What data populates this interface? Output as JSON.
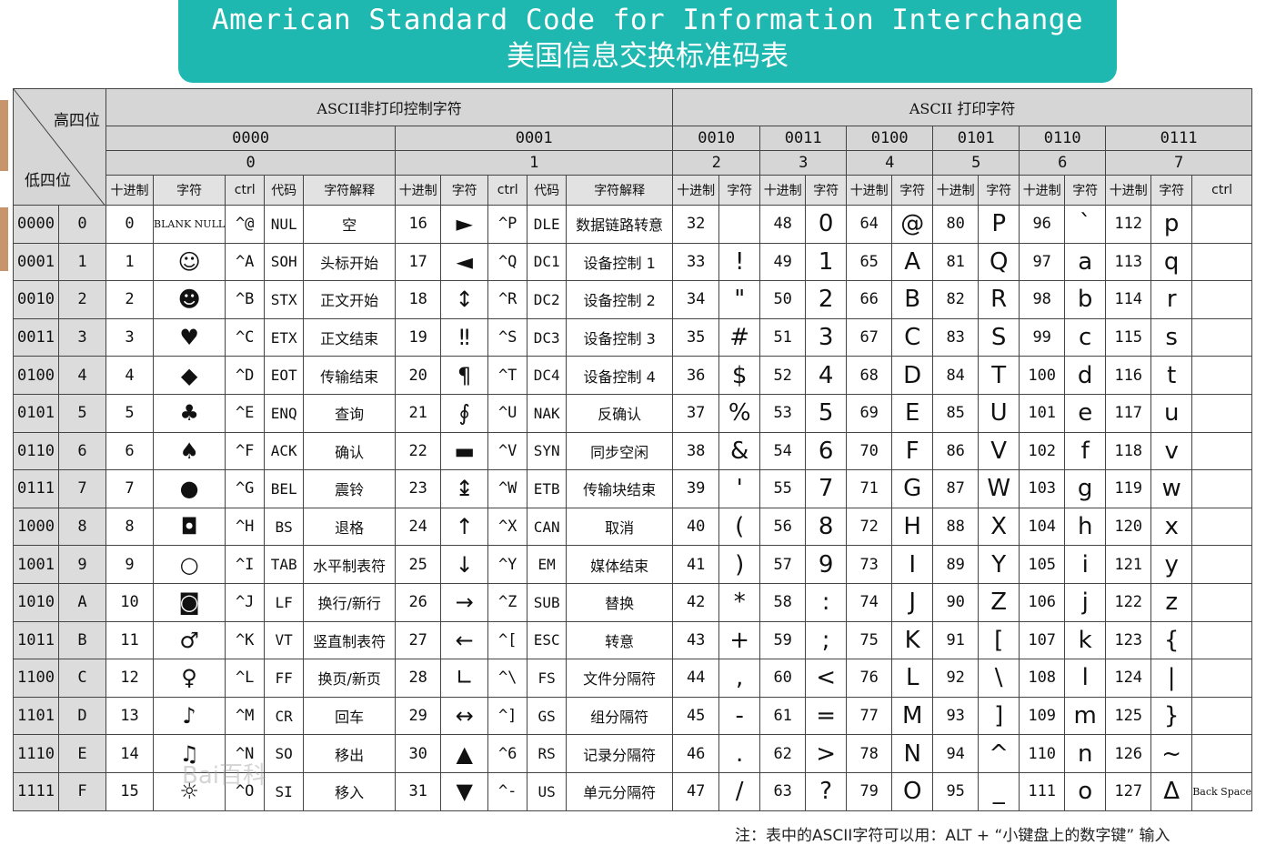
{
  "banner": {
    "title_en": "American Standard Code for Information Interchange",
    "title_zh": "美国信息交换标准码表"
  },
  "table": {
    "corner_high": "高四位",
    "corner_low": "低四位",
    "section_control": "ASCII非打印控制字符",
    "section_print": "ASCII 打印字符",
    "groups": [
      {
        "bin": "0000",
        "num": "0"
      },
      {
        "bin": "0001",
        "num": "1"
      },
      {
        "bin": "0010",
        "num": "2"
      },
      {
        "bin": "0011",
        "num": "3"
      },
      {
        "bin": "0100",
        "num": "4"
      },
      {
        "bin": "0101",
        "num": "5"
      },
      {
        "bin": "0110",
        "num": "6"
      },
      {
        "bin": "0111",
        "num": "7"
      }
    ],
    "sub_dec": "十进制",
    "sub_char": "字符",
    "sub_ctrl": "ctrl",
    "sub_code": "代码",
    "sub_desc": "字符解释",
    "rows": [
      {
        "bin": "0000",
        "hex": "0",
        "c0": {
          "dec": "0",
          "char": "BLANK NULL",
          "ctrl": "^@",
          "code": "NUL",
          "desc": "空"
        },
        "c1": {
          "dec": "16",
          "char": "►",
          "ctrl": "^P",
          "code": "DLE",
          "desc": "数据链路转意"
        },
        "p": [
          {
            "dec": "32",
            "char": ""
          },
          {
            "dec": "48",
            "char": "0"
          },
          {
            "dec": "64",
            "char": "@"
          },
          {
            "dec": "80",
            "char": "P"
          },
          {
            "dec": "96",
            "char": "`"
          },
          {
            "dec": "112",
            "char": "p"
          }
        ]
      },
      {
        "bin": "0001",
        "hex": "1",
        "c0": {
          "dec": "1",
          "char": "☺",
          "ctrl": "^A",
          "code": "SOH",
          "desc": "头标开始"
        },
        "c1": {
          "dec": "17",
          "char": "◄",
          "ctrl": "^Q",
          "code": "DC1",
          "desc": "设备控制 1"
        },
        "p": [
          {
            "dec": "33",
            "char": "!"
          },
          {
            "dec": "49",
            "char": "1"
          },
          {
            "dec": "65",
            "char": "A"
          },
          {
            "dec": "81",
            "char": "Q"
          },
          {
            "dec": "97",
            "char": "a"
          },
          {
            "dec": "113",
            "char": "q"
          }
        ]
      },
      {
        "bin": "0010",
        "hex": "2",
        "c0": {
          "dec": "2",
          "char": "☻",
          "ctrl": "^B",
          "code": "STX",
          "desc": "正文开始"
        },
        "c1": {
          "dec": "18",
          "char": "↕",
          "ctrl": "^R",
          "code": "DC2",
          "desc": "设备控制 2"
        },
        "p": [
          {
            "dec": "34",
            "char": "\""
          },
          {
            "dec": "50",
            "char": "2"
          },
          {
            "dec": "66",
            "char": "B"
          },
          {
            "dec": "82",
            "char": "R"
          },
          {
            "dec": "98",
            "char": "b"
          },
          {
            "dec": "114",
            "char": "r"
          }
        ]
      },
      {
        "bin": "0011",
        "hex": "3",
        "c0": {
          "dec": "3",
          "char": "♥",
          "ctrl": "^C",
          "code": "ETX",
          "desc": "正文结束"
        },
        "c1": {
          "dec": "19",
          "char": "‼",
          "ctrl": "^S",
          "code": "DC3",
          "desc": "设备控制 3"
        },
        "p": [
          {
            "dec": "35",
            "char": "#"
          },
          {
            "dec": "51",
            "char": "3"
          },
          {
            "dec": "67",
            "char": "C"
          },
          {
            "dec": "83",
            "char": "S"
          },
          {
            "dec": "99",
            "char": "c"
          },
          {
            "dec": "115",
            "char": "s"
          }
        ]
      },
      {
        "bin": "0100",
        "hex": "4",
        "c0": {
          "dec": "4",
          "char": "◆",
          "ctrl": "^D",
          "code": "EOT",
          "desc": "传输结束"
        },
        "c1": {
          "dec": "20",
          "char": "¶",
          "ctrl": "^T",
          "code": "DC4",
          "desc": "设备控制 4"
        },
        "p": [
          {
            "dec": "36",
            "char": "$"
          },
          {
            "dec": "52",
            "char": "4"
          },
          {
            "dec": "68",
            "char": "D"
          },
          {
            "dec": "84",
            "char": "T"
          },
          {
            "dec": "100",
            "char": "d"
          },
          {
            "dec": "116",
            "char": "t"
          }
        ]
      },
      {
        "bin": "0101",
        "hex": "5",
        "c0": {
          "dec": "5",
          "char": "♣",
          "ctrl": "^E",
          "code": "ENQ",
          "desc": "查询"
        },
        "c1": {
          "dec": "21",
          "char": "∮",
          "ctrl": "^U",
          "code": "NAK",
          "desc": "反确认"
        },
        "p": [
          {
            "dec": "37",
            "char": "%"
          },
          {
            "dec": "53",
            "char": "5"
          },
          {
            "dec": "69",
            "char": "E"
          },
          {
            "dec": "85",
            "char": "U"
          },
          {
            "dec": "101",
            "char": "e"
          },
          {
            "dec": "117",
            "char": "u"
          }
        ]
      },
      {
        "bin": "0110",
        "hex": "6",
        "c0": {
          "dec": "6",
          "char": "♠",
          "ctrl": "^F",
          "code": "ACK",
          "desc": "确认"
        },
        "c1": {
          "dec": "22",
          "char": "▬",
          "ctrl": "^V",
          "code": "SYN",
          "desc": "同步空闲"
        },
        "p": [
          {
            "dec": "38",
            "char": "&"
          },
          {
            "dec": "54",
            "char": "6"
          },
          {
            "dec": "70",
            "char": "F"
          },
          {
            "dec": "86",
            "char": "V"
          },
          {
            "dec": "102",
            "char": "f"
          },
          {
            "dec": "118",
            "char": "v"
          }
        ]
      },
      {
        "bin": "0111",
        "hex": "7",
        "c0": {
          "dec": "7",
          "char": "●",
          "ctrl": "^G",
          "code": "BEL",
          "desc": "震铃"
        },
        "c1": {
          "dec": "23",
          "char": "↨",
          "ctrl": "^W",
          "code": "ETB",
          "desc": "传输块结束"
        },
        "p": [
          {
            "dec": "39",
            "char": "'"
          },
          {
            "dec": "55",
            "char": "7"
          },
          {
            "dec": "71",
            "char": "G"
          },
          {
            "dec": "87",
            "char": "W"
          },
          {
            "dec": "103",
            "char": "g"
          },
          {
            "dec": "119",
            "char": "w"
          }
        ]
      },
      {
        "bin": "1000",
        "hex": "8",
        "c0": {
          "dec": "8",
          "char": "◘",
          "ctrl": "^H",
          "code": "BS",
          "desc": "退格"
        },
        "c1": {
          "dec": "24",
          "char": "↑",
          "ctrl": "^X",
          "code": "CAN",
          "desc": "取消"
        },
        "p": [
          {
            "dec": "40",
            "char": "("
          },
          {
            "dec": "56",
            "char": "8"
          },
          {
            "dec": "72",
            "char": "H"
          },
          {
            "dec": "88",
            "char": "X"
          },
          {
            "dec": "104",
            "char": "h"
          },
          {
            "dec": "120",
            "char": "x"
          }
        ]
      },
      {
        "bin": "1001",
        "hex": "9",
        "c0": {
          "dec": "9",
          "char": "○",
          "ctrl": "^I",
          "code": "TAB",
          "desc": "水平制表符"
        },
        "c1": {
          "dec": "25",
          "char": "↓",
          "ctrl": "^Y",
          "code": "EM",
          "desc": "媒体结束"
        },
        "p": [
          {
            "dec": "41",
            "char": ")"
          },
          {
            "dec": "57",
            "char": "9"
          },
          {
            "dec": "73",
            "char": "I"
          },
          {
            "dec": "89",
            "char": "Y"
          },
          {
            "dec": "105",
            "char": "i"
          },
          {
            "dec": "121",
            "char": "y"
          }
        ]
      },
      {
        "bin": "1010",
        "hex": "A",
        "c0": {
          "dec": "10",
          "char": "◙",
          "ctrl": "^J",
          "code": "LF",
          "desc": "换行/新行"
        },
        "c1": {
          "dec": "26",
          "char": "→",
          "ctrl": "^Z",
          "code": "SUB",
          "desc": "替换"
        },
        "p": [
          {
            "dec": "42",
            "char": "*"
          },
          {
            "dec": "58",
            "char": ":"
          },
          {
            "dec": "74",
            "char": "J"
          },
          {
            "dec": "90",
            "char": "Z"
          },
          {
            "dec": "106",
            "char": "j"
          },
          {
            "dec": "122",
            "char": "z"
          }
        ]
      },
      {
        "bin": "1011",
        "hex": "B",
        "c0": {
          "dec": "11",
          "char": "♂",
          "ctrl": "^K",
          "code": "VT",
          "desc": "竖直制表符"
        },
        "c1": {
          "dec": "27",
          "char": "←",
          "ctrl": "^[",
          "code": "ESC",
          "desc": "转意"
        },
        "p": [
          {
            "dec": "43",
            "char": "+"
          },
          {
            "dec": "59",
            "char": ";"
          },
          {
            "dec": "75",
            "char": "K"
          },
          {
            "dec": "91",
            "char": "["
          },
          {
            "dec": "107",
            "char": "k"
          },
          {
            "dec": "123",
            "char": "{"
          }
        ]
      },
      {
        "bin": "1100",
        "hex": "C",
        "c0": {
          "dec": "12",
          "char": "♀",
          "ctrl": "^L",
          "code": "FF",
          "desc": "换页/新页"
        },
        "c1": {
          "dec": "28",
          "char": "∟",
          "ctrl": "^\\",
          "code": "FS",
          "desc": "文件分隔符"
        },
        "p": [
          {
            "dec": "44",
            "char": ","
          },
          {
            "dec": "60",
            "char": "<"
          },
          {
            "dec": "76",
            "char": "L"
          },
          {
            "dec": "92",
            "char": "\\"
          },
          {
            "dec": "108",
            "char": "l"
          },
          {
            "dec": "124",
            "char": "|"
          }
        ]
      },
      {
        "bin": "1101",
        "hex": "D",
        "c0": {
          "dec": "13",
          "char": "♪",
          "ctrl": "^M",
          "code": "CR",
          "desc": "回车"
        },
        "c1": {
          "dec": "29",
          "char": "↔",
          "ctrl": "^]",
          "code": "GS",
          "desc": "组分隔符"
        },
        "p": [
          {
            "dec": "45",
            "char": "-"
          },
          {
            "dec": "61",
            "char": "="
          },
          {
            "dec": "77",
            "char": "M"
          },
          {
            "dec": "93",
            "char": "]"
          },
          {
            "dec": "109",
            "char": "m"
          },
          {
            "dec": "125",
            "char": "}"
          }
        ]
      },
      {
        "bin": "1110",
        "hex": "E",
        "c0": {
          "dec": "14",
          "char": "♫",
          "ctrl": "^N",
          "code": "SO",
          "desc": "移出"
        },
        "c1": {
          "dec": "30",
          "char": "▲",
          "ctrl": "^6",
          "code": "RS",
          "desc": "记录分隔符"
        },
        "p": [
          {
            "dec": "46",
            "char": "."
          },
          {
            "dec": "62",
            "char": ">"
          },
          {
            "dec": "78",
            "char": "N"
          },
          {
            "dec": "94",
            "char": "^"
          },
          {
            "dec": "110",
            "char": "n"
          },
          {
            "dec": "126",
            "char": "~"
          }
        ]
      },
      {
        "bin": "1111",
        "hex": "F",
        "c0": {
          "dec": "15",
          "char": "☼",
          "ctrl": "^O",
          "code": "SI",
          "desc": "移入"
        },
        "c1": {
          "dec": "31",
          "char": "▼",
          "ctrl": "^-",
          "code": "US",
          "desc": "单元分隔符"
        },
        "p": [
          {
            "dec": "47",
            "char": "/"
          },
          {
            "dec": "63",
            "char": "?"
          },
          {
            "dec": "79",
            "char": "O"
          },
          {
            "dec": "95",
            "char": "_"
          },
          {
            "dec": "111",
            "char": "o"
          },
          {
            "dec": "127",
            "char": "Δ"
          }
        ],
        "ctrl_last": "Back Space"
      }
    ]
  },
  "footnote": "注：表中的ASCII字符可以用：ALT + “小键盘上的数字键” 输入",
  "watermark": "Bai百科",
  "colors": {
    "banner": "#1fb8b1",
    "header": "#d6d6d6"
  }
}
